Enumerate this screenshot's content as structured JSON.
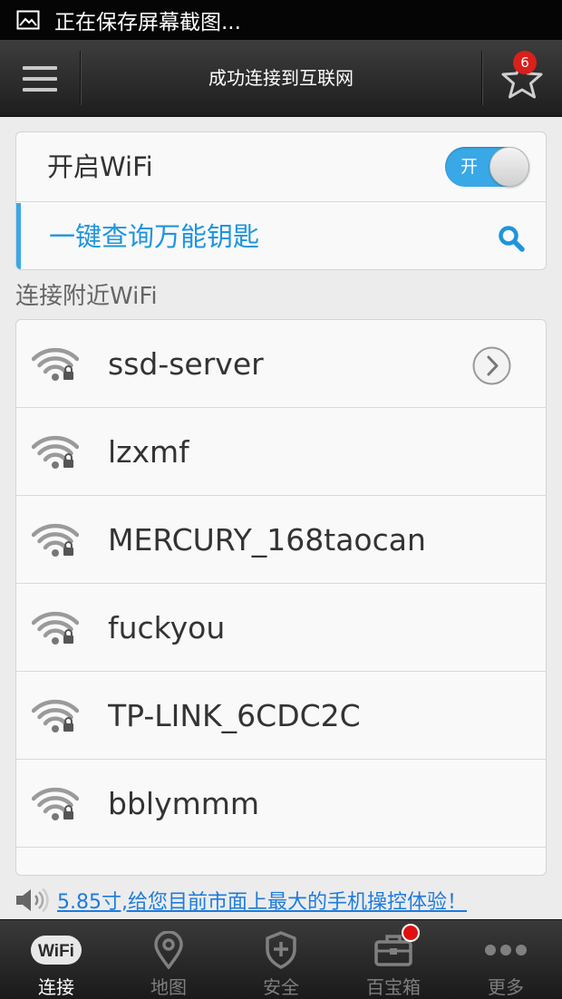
{
  "status_bar": {
    "icon": "image-icon",
    "text": "正在保存屏幕截图..."
  },
  "top_bar": {
    "menu_icon": "menu-icon",
    "title": "成功连接到互联网",
    "favorites_icon": "star-icon",
    "favorites_badge": "6"
  },
  "wifi_card": {
    "wifi_label": "开启WiFi",
    "toggle_label": "开",
    "toggle_on": true,
    "key_query_label": "一键查询万能钥匙",
    "key_query_icon": "search-icon"
  },
  "nearby": {
    "section_title": "连接附近WiFi",
    "networks": [
      {
        "ssid": "ssd-server",
        "locked": true,
        "has_detail": true
      },
      {
        "ssid": "lzxmf",
        "locked": true
      },
      {
        "ssid": "MERCURY_168taocan",
        "locked": true
      },
      {
        "ssid": "fuckyou",
        "locked": true
      },
      {
        "ssid": "TP-LINK_6CDC2C",
        "locked": true
      },
      {
        "ssid": "bblymmm",
        "locked": true
      },
      {
        "ssid": "",
        "locked": true
      }
    ]
  },
  "notice": {
    "icon": "speaker-icon",
    "text": "5.85寸,给您目前市面上最大的手机操控体验！"
  },
  "tab_bar": {
    "tabs": [
      {
        "label": "连接",
        "icon": "wifi-icon",
        "active": true
      },
      {
        "label": "地图",
        "icon": "map-pin-icon",
        "active": false
      },
      {
        "label": "安全",
        "icon": "shield-icon",
        "active": false
      },
      {
        "label": "百宝箱",
        "icon": "toolbox-icon",
        "active": false,
        "badge": true
      },
      {
        "label": "更多",
        "icon": "more-icon",
        "active": false
      }
    ]
  },
  "colors": {
    "accent": "#39a8e6",
    "link": "#1e7bdc",
    "badge": "#d8201c",
    "top_bar": "#2e2e2e"
  }
}
